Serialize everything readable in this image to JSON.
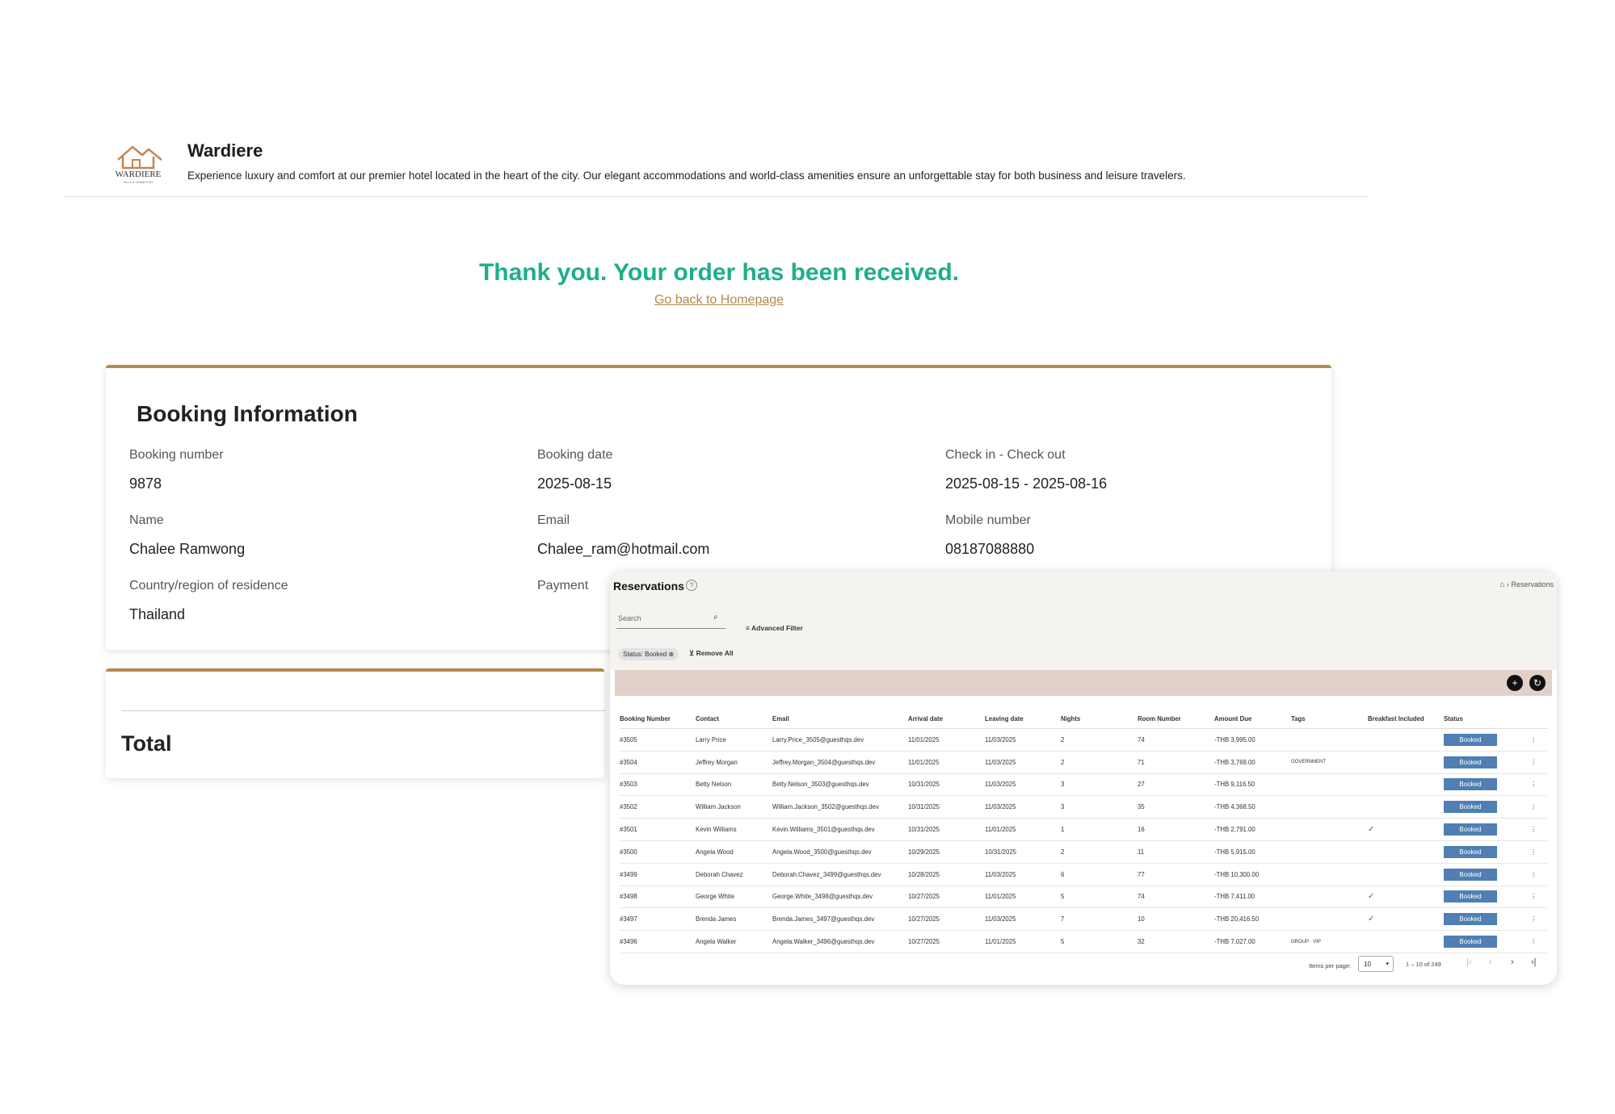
{
  "brand": {
    "name": "Wardiere",
    "logo_text": "WARDIERE",
    "logo_subtext": "VILLA & HOMESTAY",
    "description": "Experience luxury and comfort at our premier hotel located in the heart of the city. Our elegant accommodations and world-class amenities ensure an unforgettable stay for both business and leisure travelers."
  },
  "confirmation": {
    "title": "Thank you. Your order has been received.",
    "link": "Go back to Homepage"
  },
  "booking": {
    "title": "Booking Information",
    "fields": {
      "booking_number": {
        "label": "Booking number",
        "value": "9878"
      },
      "booking_date": {
        "label": "Booking date",
        "value": "2025-08-15"
      },
      "check_in_out": {
        "label": "Check in - Check out",
        "value": "2025-08-15 - 2025-08-16"
      },
      "name": {
        "label": "Name",
        "value": "Chalee Ramwong"
      },
      "email": {
        "label": "Email",
        "value": "Chalee_ram@hotmail.com"
      },
      "mobile": {
        "label": "Mobile number",
        "value": "08187088880"
      },
      "country": {
        "label": "Country/region of residence",
        "value": "Thailand"
      },
      "payment": {
        "label": "Payment"
      }
    },
    "total_label": "Total"
  },
  "reservations": {
    "title": "Reservations",
    "breadcrumb": "Reservations",
    "search_placeholder": "Search",
    "advanced_filter": "Advanced Filter",
    "chip": "Status: Booked",
    "remove_all": "Remove All",
    "columns": [
      "Booking Number",
      "Contact",
      "Email",
      "Arrival date",
      "Leaving date",
      "Nights",
      "Room Number",
      "Amount Due",
      "Tags",
      "Breakfast Included",
      "Status"
    ],
    "rows": [
      {
        "num": "#3505",
        "contact": "Larry Price",
        "email": "Larry.Price_3505@guesthqs.dev",
        "arrival": "11/01/2025",
        "leaving": "11/03/2025",
        "nights": "2",
        "room": "74",
        "amount": "-THB 3,995.00",
        "tags": "",
        "breakfast": "",
        "status": "Booked"
      },
      {
        "num": "#3504",
        "contact": "Jeffrey Morgan",
        "email": "Jeffrey.Morgan_3504@guesthqs.dev",
        "arrival": "11/01/2025",
        "leaving": "11/03/2025",
        "nights": "2",
        "room": "71",
        "amount": "-THB 3,769.00",
        "tags": "GOVERNMENT",
        "breakfast": "",
        "status": "Booked"
      },
      {
        "num": "#3503",
        "contact": "Betty Nelson",
        "email": "Betty.Nelson_3503@guesthqs.dev",
        "arrival": "10/31/2025",
        "leaving": "11/03/2025",
        "nights": "3",
        "room": "27",
        "amount": "-THB 9,116.50",
        "tags": "",
        "breakfast": "",
        "status": "Booked"
      },
      {
        "num": "#3502",
        "contact": "William Jackson",
        "email": "William.Jackson_3502@guesthqs.dev",
        "arrival": "10/31/2025",
        "leaving": "11/03/2025",
        "nights": "3",
        "room": "35",
        "amount": "-THB 4,368.50",
        "tags": "",
        "breakfast": "",
        "status": "Booked"
      },
      {
        "num": "#3501",
        "contact": "Kevin Williams",
        "email": "Kevin.Williams_3501@guesthqs.dev",
        "arrival": "10/31/2025",
        "leaving": "11/01/2025",
        "nights": "1",
        "room": "16",
        "amount": "-THB 2,791.00",
        "tags": "",
        "breakfast": "✓",
        "status": "Booked"
      },
      {
        "num": "#3500",
        "contact": "Angela Wood",
        "email": "Angela.Wood_3500@guesthqs.dev",
        "arrival": "10/29/2025",
        "leaving": "10/31/2025",
        "nights": "2",
        "room": "11",
        "amount": "-THB 5,915.00",
        "tags": "",
        "breakfast": "",
        "status": "Booked"
      },
      {
        "num": "#3499",
        "contact": "Deborah Chavez",
        "email": "Deborah.Chavez_3499@guesthqs.dev",
        "arrival": "10/28/2025",
        "leaving": "11/03/2025",
        "nights": "6",
        "room": "77",
        "amount": "-THB 10,300.00",
        "tags": "",
        "breakfast": "",
        "status": "Booked"
      },
      {
        "num": "#3498",
        "contact": "George White",
        "email": "George.White_3498@guesthqs.dev",
        "arrival": "10/27/2025",
        "leaving": "11/01/2025",
        "nights": "5",
        "room": "74",
        "amount": "-THB 7,411.00",
        "tags": "",
        "breakfast": "✓",
        "status": "Booked"
      },
      {
        "num": "#3497",
        "contact": "Brenda James",
        "email": "Brenda.James_3497@guesthqs.dev",
        "arrival": "10/27/2025",
        "leaving": "11/03/2025",
        "nights": "7",
        "room": "10",
        "amount": "-THB 20,416.50",
        "tags": "",
        "breakfast": "✓",
        "status": "Booked"
      },
      {
        "num": "#3496",
        "contact": "Angela Walker",
        "email": "Angela.Walker_3496@guesthqs.dev",
        "arrival": "10/27/2025",
        "leaving": "11/01/2025",
        "nights": "5",
        "room": "32",
        "amount": "-THB 7,027.00",
        "tags": "GROUP · VIP",
        "breakfast": "",
        "status": "Booked"
      }
    ],
    "pager": {
      "items_per_page_label": "Items per page:",
      "items_per_page": "10",
      "range": "1 – 10 of 249"
    }
  }
}
